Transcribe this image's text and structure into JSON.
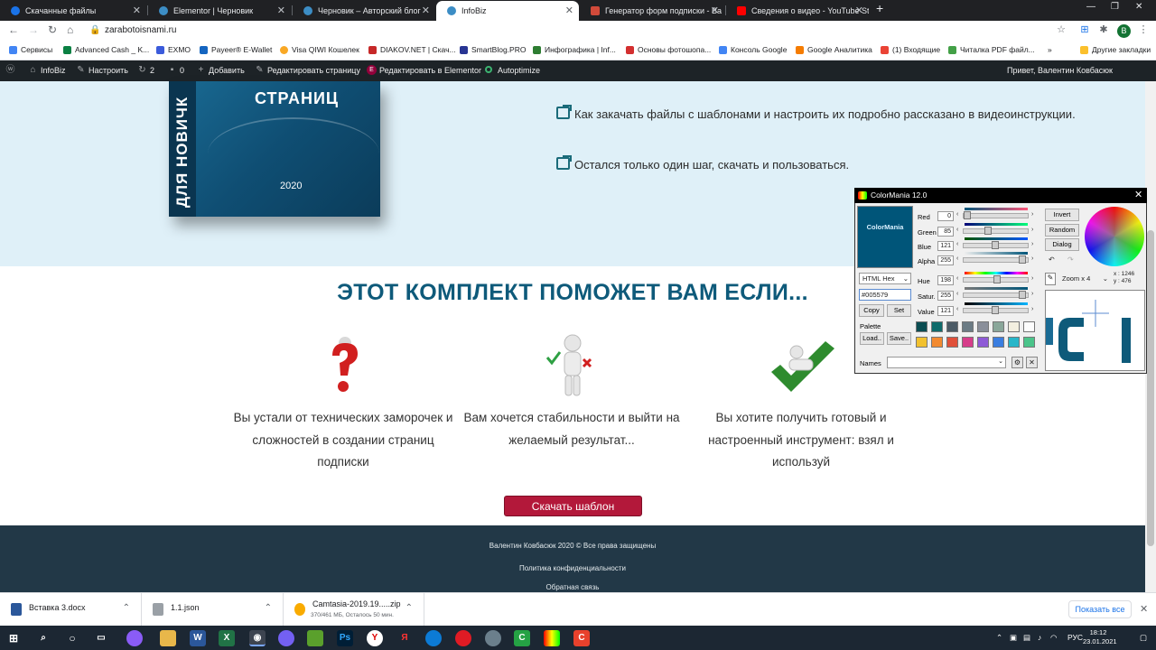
{
  "browser": {
    "tabs": [
      {
        "label": "Скачанные файлы",
        "icon_color": "#1a73e8",
        "active": false
      },
      {
        "label": "Elementor | Черновик",
        "icon_color": "#3c8dc5",
        "active": false
      },
      {
        "label": "Черновик – Авторский блог",
        "icon_color": "#3c8dc5",
        "active": false
      },
      {
        "label": "InfoBiz",
        "icon_color": "#3c8dc5",
        "active": true
      },
      {
        "label": "Генератор форм подписки - Ва",
        "icon_color": "#d14a3a",
        "active": false
      },
      {
        "label": "Сведения о видео - YouTube Stu",
        "icon_color": "#ff0000",
        "active": false
      }
    ],
    "new_tab": "+",
    "url": "zarabotoisnami.ru",
    "avatar_letter": "В",
    "bookmarks": [
      {
        "label": "Сервисы",
        "color": "#4285f4"
      },
      {
        "label": "Advanced Cash _ K...",
        "color": "#0b8043"
      },
      {
        "label": "EXMO",
        "color": "#3b5bdb"
      },
      {
        "label": "Payeer® E-Wallet",
        "color": "#1565c0"
      },
      {
        "label": "Visa QIWI Кошелек",
        "color": "#f9a825"
      },
      {
        "label": "DIAKOV.NET | Скач...",
        "color": "#c62828"
      },
      {
        "label": "SmartBlog.PRO",
        "color": "#283593"
      },
      {
        "label": "Инфографика | Inf...",
        "color": "#2e7d32"
      },
      {
        "label": "Основы фотошопа...",
        "color": "#d32f2f"
      },
      {
        "label": "Консоль Google",
        "color": "#4285f4"
      },
      {
        "label": "Google Аналитика",
        "color": "#f57c00"
      },
      {
        "label": "(1) Входящие",
        "color": "#ea4335"
      },
      {
        "label": "Читалка PDF файл...",
        "color": "#43a047"
      },
      {
        "label": "»",
        "color": ""
      },
      {
        "label": "Другие закладки",
        "color": "#fbc02d"
      }
    ]
  },
  "wpbar": {
    "items": [
      {
        "label": "",
        "icon": "wordpress-icon"
      },
      {
        "label": "InfoBiz",
        "icon": "home-icon"
      },
      {
        "label": "Настроить",
        "icon": "brush-icon"
      },
      {
        "label": "2",
        "icon": "refresh-icon"
      },
      {
        "label": "0",
        "icon": "comment-icon"
      },
      {
        "label": "Добавить",
        "icon": "plus-icon"
      },
      {
        "label": "Редактировать страницу",
        "icon": "pencil-icon"
      },
      {
        "label": "Редактировать в Elementor",
        "icon": "elementor-icon"
      },
      {
        "label": "Autoptimize",
        "icon": "status-dot-icon"
      }
    ],
    "greeting": "Привет, Валентин Ковбасюк"
  },
  "hero": {
    "box_title": "СТРАНИЦ",
    "box_side": "ДЛЯ НОВИЧК",
    "box_year": "2020",
    "lines": [
      "Как закачать файлы с шаблонами и настроить их подробно рассказано в видеоинструкции.",
      "Остался только один шаг, скачать и пользоваться."
    ]
  },
  "section": {
    "title": "ЭТОТ КОМПЛЕКТ ПОМОЖЕТ ВАМ ЕСЛИ...",
    "features": [
      "Вы устали от технических заморочек и сложностей в создании страниц подписки",
      "Вам хочется стабильности и выйти на желаемый результат...",
      "Вы хотите получить готовый и настроенный инструмент: взял и используй"
    ],
    "button": "Скачать шаблон"
  },
  "footer": {
    "copyright": "Валентин Ковбасюк 2020 ©  Все права защищены",
    "privacy": "Политика конфиденциальности",
    "feedback": "Обратная связь"
  },
  "downloads": {
    "items": [
      {
        "name": "Вставка 3.docx",
        "sub": "",
        "color": "#2b579a"
      },
      {
        "name": "1.1.json",
        "sub": "",
        "color": "#9aa0a6"
      },
      {
        "name": "Camtasia-2019.19.....zip",
        "sub": "370/461 МБ, Осталось 50 мин.",
        "color": "#f9ab00"
      }
    ],
    "show_all": "Показать все"
  },
  "taskbar": {
    "lang": "РУС",
    "time": "18:12",
    "date": "23.01.2021"
  },
  "colormania": {
    "title": "ColorMania 12.0",
    "swatch_label": "ColorMania",
    "swatch_color": "#005579",
    "rows": [
      {
        "label": "Red",
        "value": "0"
      },
      {
        "label": "Green",
        "value": "85"
      },
      {
        "label": "Blue",
        "value": "121"
      },
      {
        "label": "Alpha",
        "value": "255"
      },
      {
        "label": "Hue",
        "value": "198"
      },
      {
        "label": "Satur.",
        "value": "255"
      },
      {
        "label": "Value",
        "value": "121"
      }
    ],
    "buttons": {
      "invert": "Invert",
      "random": "Random",
      "dialog": "Dialog",
      "copy": "Copy",
      "set": "Set",
      "load": "Load..",
      "save": "Save.."
    },
    "format": "HTML Hex",
    "hex": "#005579",
    "palette_label": "Palette",
    "zoom": "Zoom x 4",
    "coords": {
      "x": "x : 1246",
      "y": "y :  476"
    },
    "names_label": "Names",
    "palette": [
      "#0b4d52",
      "#0f6b6b",
      "#4c5b66",
      "#6b7b84",
      "#8a8f9a",
      "#8aa79a",
      "#f3efe0",
      "#fdfdfd",
      "#f2c12e",
      "#f28a30",
      "#e0503a",
      "#d63d8a",
      "#8e5ad6",
      "#3a7ee0",
      "#28b6c9",
      "#4bc48a"
    ]
  }
}
